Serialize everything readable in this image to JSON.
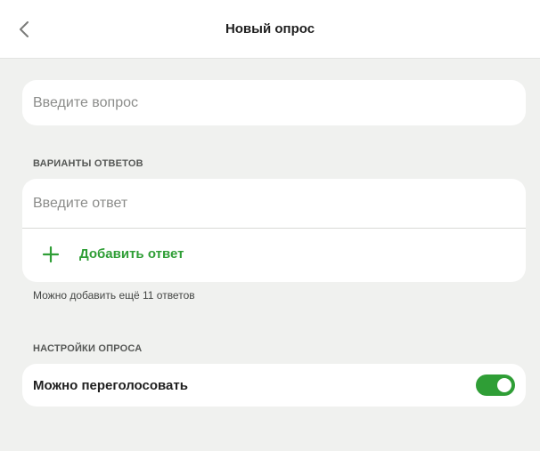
{
  "header": {
    "title": "Новый опрос",
    "back_icon": "chevron-left-icon"
  },
  "question": {
    "placeholder": "Введите вопрос",
    "value": ""
  },
  "answers_section": {
    "title": "ВАРИАНТЫ ОТВЕТОВ",
    "answer_placeholder": "Введите ответ",
    "answer_value": "",
    "add_label": "Добавить ответ",
    "add_icon": "plus-icon",
    "hint": "Можно добавить ещё 11 ответов"
  },
  "settings_section": {
    "title": "НАСТРОЙКИ ОПРОСА",
    "revote_label": "Можно переголосовать",
    "revote_enabled": true
  },
  "colors": {
    "accent": "#2f9e36",
    "page_background": "#f0f1ef",
    "card_background": "#ffffff"
  }
}
